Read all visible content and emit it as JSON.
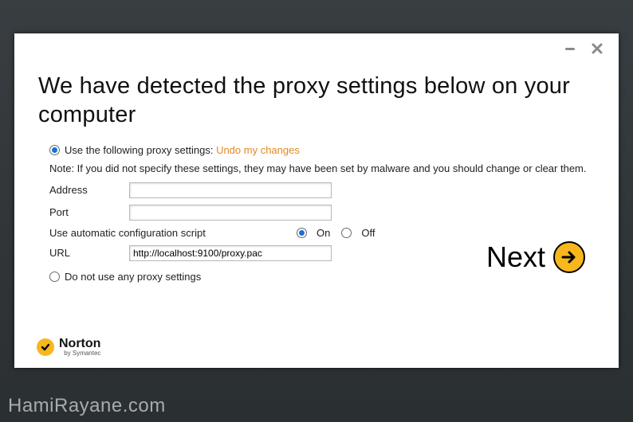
{
  "window": {
    "heading": "We have detected the proxy settings below on your computer"
  },
  "proxy": {
    "use_label": "Use the following proxy settings:",
    "undo_link": "Undo my changes",
    "note": "Note: If you did not specify these settings, they may have been set by malware and you should change or clear them.",
    "address_label": "Address",
    "address_value": "",
    "port_label": "Port",
    "port_value": "",
    "script_label": "Use automatic configuration script",
    "on_label": "On",
    "off_label": "Off",
    "url_label": "URL",
    "url_value": "http://localhost:9100/proxy.pac",
    "no_proxy_label": "Do not use any proxy settings"
  },
  "actions": {
    "next_label": "Next"
  },
  "branding": {
    "logo_main": "Norton",
    "logo_sub": "by Symantec"
  },
  "watermark": "HamiRayane.com"
}
